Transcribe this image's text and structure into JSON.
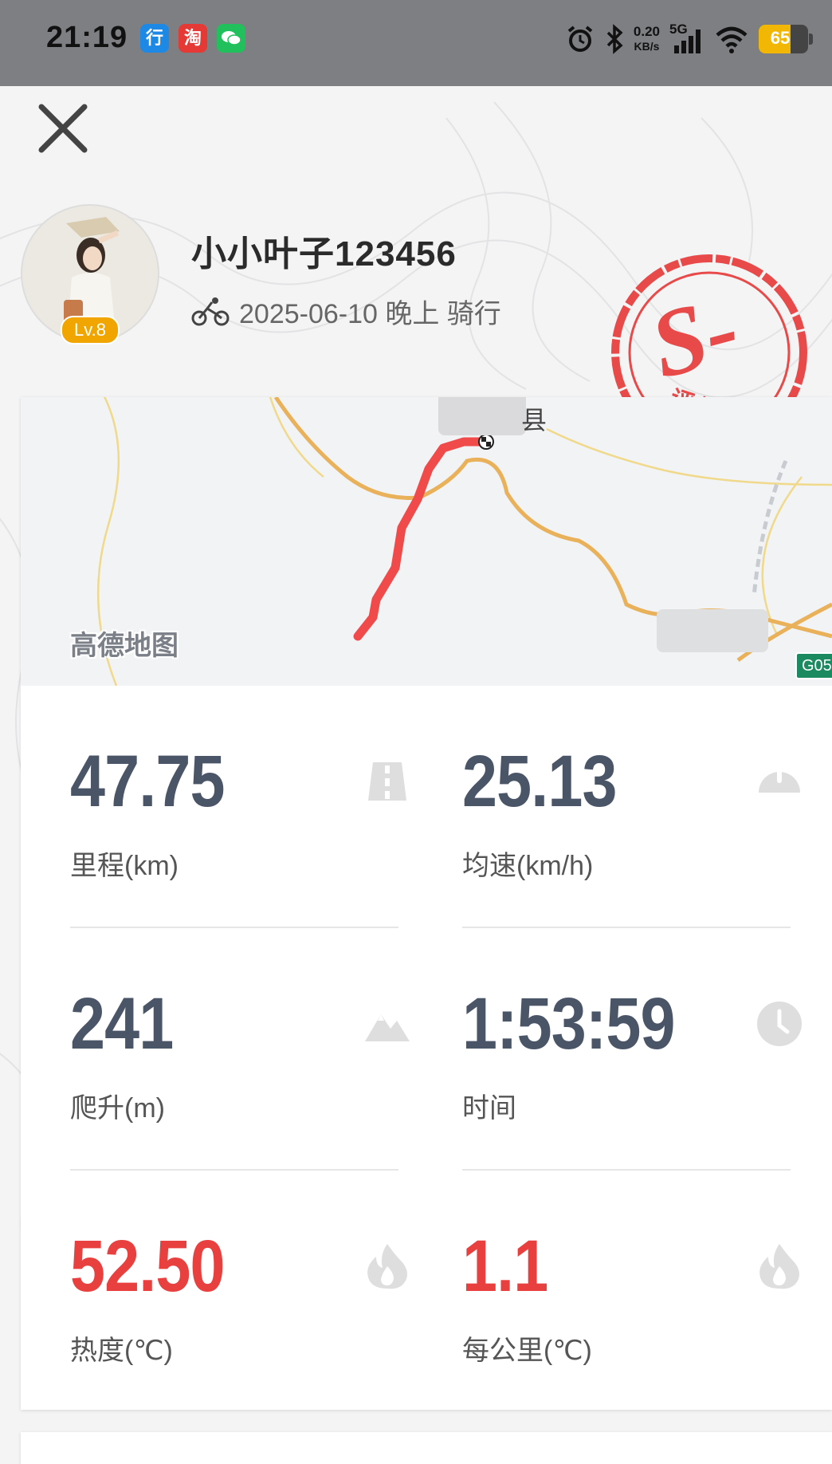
{
  "status_bar": {
    "time": "21:19",
    "app_icons": [
      {
        "name": "hangxing-app-icon",
        "glyph": "行",
        "color": "#1e88e5"
      },
      {
        "name": "taobao-app-icon",
        "glyph": "淘",
        "color": "#e53935"
      },
      {
        "name": "wechat-app-icon",
        "glyph": "●",
        "color": "#22c05c"
      }
    ],
    "net_speed_value": "0.20",
    "net_speed_unit": "KB/s",
    "network": "5G",
    "battery": "65"
  },
  "profile": {
    "username": "小小叶子123456",
    "level": "Lv.8",
    "activity_meta": "2025-06-10 晚上 骑行"
  },
  "stamp": {
    "grade": "S-",
    "label": "评分",
    "color": "#e84a4a"
  },
  "map": {
    "provider": "高德地图",
    "county_label": "县",
    "road_tag": "G05"
  },
  "stats": [
    {
      "value": "47.75",
      "label": "里程(km)",
      "icon": "road-icon",
      "highlight": false
    },
    {
      "value": "25.13",
      "label": "均速(km/h)",
      "icon": "speedometer-icon",
      "highlight": false
    },
    {
      "value": "241",
      "label": "爬升(m)",
      "icon": "mountain-icon",
      "highlight": false
    },
    {
      "value": "1:53:59",
      "label": "时间",
      "icon": "clock-icon",
      "highlight": false
    },
    {
      "value": "52.50",
      "label": "热度(℃)",
      "icon": "flame-icon",
      "highlight": true
    },
    {
      "value": "1.1",
      "label": "每公里(℃)",
      "icon": "flame-icon",
      "highlight": true
    }
  ],
  "colors": {
    "accent_red": "#e8403f",
    "stat_gray": "#4a5568",
    "level_badge": "#f0a500",
    "route": "#f04a4a"
  }
}
